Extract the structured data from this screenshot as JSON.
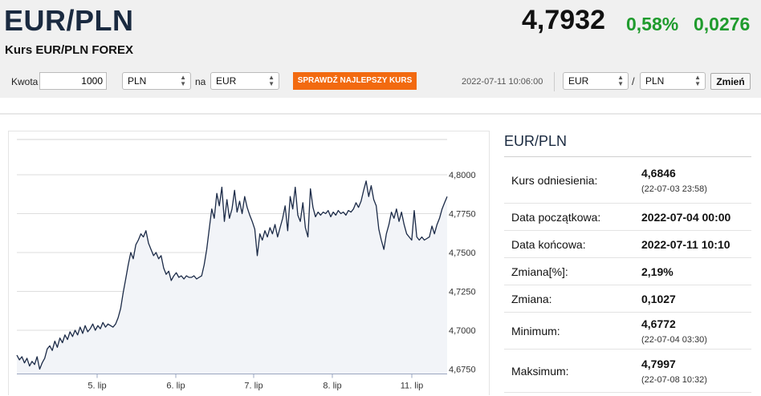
{
  "header": {
    "pair": "EUR/PLN",
    "subtitle": "Kurs EUR/PLN FOREX",
    "rate": "4,7932",
    "change_pct": "0,58%",
    "change_abs": "0,0276"
  },
  "toolbar": {
    "amount_label": "Kwota",
    "amount_value": "1000",
    "from_currency": "PLN",
    "to_label": "na",
    "to_currency": "EUR",
    "best_rate_button": "SPRAWDŹ NAJLEPSZY KURS",
    "timestamp": "2022-07-11 10:06:00",
    "base_currency": "EUR",
    "slash": "/",
    "quote_currency": "PLN",
    "change_button": "Zmień"
  },
  "colors": {
    "accent": "#f26a10",
    "positive": "#1f9b2d",
    "line": "#1b2a47"
  },
  "chart_data": {
    "type": "line",
    "categories": [
      "5. lip",
      "6. lip",
      "7. lip",
      "8. lip",
      "11. lip"
    ],
    "y_ticks": [
      "4,8000",
      "4,7750",
      "4,7500",
      "4,7250",
      "4,7000",
      "4,6750"
    ],
    "ylim": [
      4.67,
      4.81
    ],
    "grid": true,
    "series": [
      {
        "values": [
          4.684,
          4.681,
          4.683,
          4.679,
          4.682,
          4.677,
          4.68,
          4.678,
          4.683,
          4.675,
          4.679,
          4.682,
          4.688,
          4.69,
          4.687,
          4.693,
          4.689,
          4.695,
          4.692,
          4.697,
          4.694,
          4.699,
          4.696,
          4.7,
          4.697,
          4.702,
          4.698,
          4.703,
          4.699,
          4.701,
          4.704,
          4.7,
          4.703,
          4.701,
          4.705,
          4.702,
          4.704,
          4.703,
          4.702,
          4.704,
          4.708,
          4.714,
          4.724,
          4.733,
          4.742,
          4.75,
          4.746,
          4.755,
          4.758,
          4.762,
          4.76,
          4.764,
          4.756,
          4.752,
          4.748,
          4.75,
          4.746,
          4.748,
          4.74,
          4.736,
          4.738,
          4.732,
          4.735,
          4.737,
          4.734,
          4.735,
          4.733,
          4.735,
          4.734,
          4.734,
          4.735,
          4.733,
          4.734,
          4.735,
          4.742,
          4.752,
          4.765,
          4.778,
          4.772,
          4.788,
          4.78,
          4.792,
          4.77,
          4.784,
          4.772,
          4.778,
          4.79,
          4.776,
          4.783,
          4.775,
          4.786,
          4.779,
          4.774,
          4.77,
          4.765,
          4.748,
          4.762,
          4.758,
          4.764,
          4.76,
          4.766,
          4.762,
          4.768,
          4.76,
          4.766,
          4.772,
          4.78,
          4.764,
          4.786,
          4.778,
          4.792,
          4.774,
          4.77,
          4.782,
          4.766,
          4.76,
          4.791,
          4.779,
          4.773,
          4.776,
          4.774,
          4.776,
          4.775,
          4.777,
          4.773,
          4.776,
          4.774,
          4.777,
          4.775,
          4.776,
          4.774,
          4.777,
          4.776,
          4.778,
          4.782,
          4.779,
          4.783,
          4.79,
          4.796,
          4.786,
          4.793,
          4.784,
          4.78,
          4.765,
          4.758,
          4.752,
          4.762,
          4.768,
          4.776,
          4.772,
          4.778,
          4.77,
          4.776,
          4.768,
          4.762,
          4.76,
          4.758,
          4.777,
          4.76,
          4.758,
          4.76,
          4.758,
          4.759,
          4.76,
          4.767,
          4.762,
          4.768,
          4.772,
          4.778,
          4.782,
          4.786
        ]
      }
    ]
  },
  "panel": {
    "title": "EUR/PLN",
    "rows": [
      {
        "label": "Kurs odniesienia:",
        "value": "4,6846",
        "sub": "(22-07-03 23:58)"
      },
      {
        "label": "Data początkowa:",
        "value": "2022-07-04 00:00"
      },
      {
        "label": "Data końcowa:",
        "value": "2022-07-11 10:10"
      },
      {
        "label": "Zmiana[%]:",
        "value": "2,19%"
      },
      {
        "label": "Zmiana:",
        "value": "0,1027"
      },
      {
        "label": "Minimum:",
        "value": "4,6772",
        "sub": "(22-07-04 03:30)"
      },
      {
        "label": "Maksimum:",
        "value": "4,7997",
        "sub": "(22-07-08 10:32)"
      }
    ]
  }
}
